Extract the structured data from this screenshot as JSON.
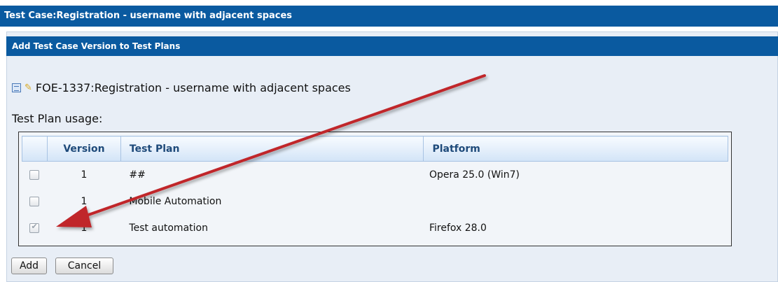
{
  "window": {
    "title": "Test Case:Registration - username with adjacent spaces"
  },
  "section": {
    "title": "Add Test Case Version to Test Plans"
  },
  "test_case": {
    "label": "FOE-1337:Registration - username with adjacent spaces"
  },
  "usage": {
    "label": "Test Plan usage:"
  },
  "table": {
    "headers": {
      "version": "Version",
      "test_plan": "Test Plan",
      "platform": "Platform"
    },
    "rows": [
      {
        "version": "1",
        "test_plan": "##",
        "platform": "Opera 25.0 (Win7)",
        "checked": false
      },
      {
        "version": "1",
        "test_plan": "Mobile Automation",
        "platform": "",
        "checked": false
      },
      {
        "version": "1",
        "test_plan": "Test automation",
        "platform": "Firefox 28.0",
        "checked": true
      }
    ]
  },
  "buttons": {
    "add": "Add",
    "cancel": "Cancel"
  },
  "colors": {
    "header_bar": "#0a5aa0",
    "annotation_arrow": "#c0262a"
  },
  "icons": [
    "document-icon",
    "pencil-icon",
    "checkbox-icon"
  ]
}
